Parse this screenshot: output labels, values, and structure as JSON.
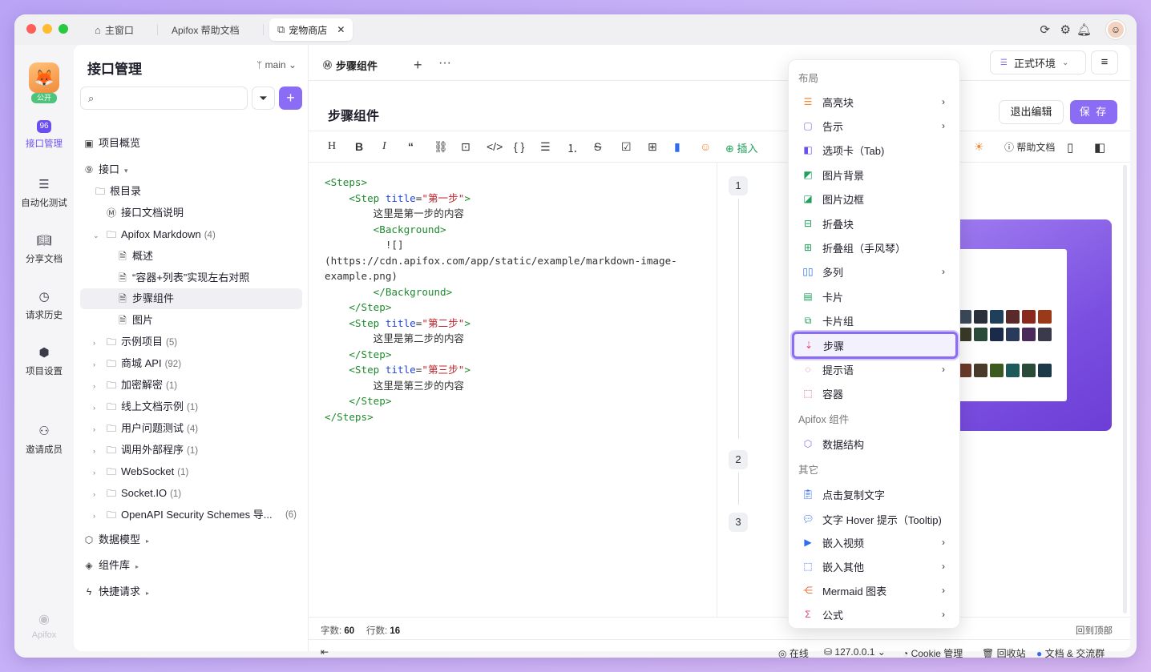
{
  "tabs": [
    {
      "label": "主窗口",
      "icon": "home-icon"
    },
    {
      "label": "Apifox 帮助文档"
    },
    {
      "label": "宠物商店",
      "icon": "external-link-icon",
      "active": true
    }
  ],
  "rail": {
    "badge": "公开",
    "items": [
      {
        "label": "接口管理",
        "icon": "api-icon",
        "active": true
      },
      {
        "label": "自动化测试",
        "icon": "test-icon"
      },
      {
        "label": "分享文档",
        "icon": "book-icon"
      },
      {
        "label": "请求历史",
        "icon": "clock-icon"
      },
      {
        "label": "项目设置",
        "icon": "settings-icon"
      },
      {
        "label": "邀请成员",
        "icon": "user-add-icon"
      }
    ],
    "footer": "Apifox"
  },
  "tree": {
    "title": "接口管理",
    "branch": "main",
    "nodes": [
      {
        "label": "项目概览",
        "icon": "overview-icon"
      },
      {
        "label": "接口",
        "icon": "api-icon"
      },
      {
        "label": "根目录",
        "icon": "folder-icon"
      },
      {
        "label": "接口文档说明",
        "icon": "markdown-icon"
      },
      {
        "label": "Apifox Markdown",
        "count": "(4)",
        "icon": "folder-icon"
      },
      {
        "label": "概述",
        "icon": "doc-icon"
      },
      {
        "label": "“容器+列表”实现左右对照",
        "icon": "doc-icon"
      },
      {
        "label": "步骤组件",
        "icon": "doc-icon",
        "selected": true
      },
      {
        "label": "图片",
        "icon": "doc-icon"
      },
      {
        "label": "示例项目",
        "count": "(5)"
      },
      {
        "label": "商城 API",
        "count": "(92)"
      },
      {
        "label": "加密解密",
        "count": "(1)"
      },
      {
        "label": "线上文档示例",
        "count": "(1)"
      },
      {
        "label": "用户问题测试",
        "count": "(4)"
      },
      {
        "label": "调用外部程序",
        "count": "(1)"
      },
      {
        "label": "WebSocket",
        "count": "(1)"
      },
      {
        "label": "Socket.IO",
        "count": "(1)"
      },
      {
        "label": "OpenAPI Security Schemes 导...",
        "count": "(6)"
      },
      {
        "label": "数据模型",
        "icon": "cube-icon"
      },
      {
        "label": "组件库",
        "icon": "layers-icon"
      },
      {
        "label": "快捷请求",
        "icon": "bolt-icon"
      }
    ]
  },
  "editor": {
    "tab_label": "步骤组件",
    "env": "正式环境",
    "title": "步骤组件",
    "exit": "退出编辑",
    "save": "保 存",
    "insert": "插入",
    "help": "帮助文档",
    "code": [
      "<Steps>",
      "    <Step title=\"第一步\">",
      "        这里是第一步的内容",
      "        <Background>",
      "          ![](https://cdn.apifox.com/app/static/example/markdown-image-example.png)",
      "        </Background>",
      "    </Step>",
      "    <Step title=\"第二步\">",
      "        这里是第二步的内容",
      "    </Step>",
      "    <Step title=\"第三步\">",
      "        这里是第三步的内容",
      "    </Step>",
      "</Steps>"
    ],
    "preview_steps": [
      "1",
      "2",
      "3"
    ],
    "stats": {
      "chars_label": "字数:",
      "chars": "60",
      "lines_label": "行数:",
      "lines": "16"
    },
    "back_to_top": "回到顶部"
  },
  "footer": {
    "online": "在线",
    "ip": "127.0.0.1",
    "cookie": "Cookie 管理",
    "recycle": "回收站",
    "docs": "文档 & 交流群"
  },
  "menu": {
    "sections": [
      "布局",
      "Apifox 组件",
      "其它"
    ],
    "items": [
      {
        "label": "高亮块",
        "icon": "highlight-icon",
        "color": "#f08a3a",
        "submenu": true
      },
      {
        "label": "告示",
        "icon": "notice-icon",
        "color": "#8b6cf5",
        "submenu": true
      },
      {
        "label": "选项卡（Tab)",
        "icon": "tab-icon",
        "color": "#6b4ef0"
      },
      {
        "label": "图片背景",
        "icon": "image-bg-icon",
        "color": "#20a05a"
      },
      {
        "label": "图片边框",
        "icon": "image-frame-icon",
        "color": "#20a05a"
      },
      {
        "label": "折叠块",
        "icon": "collapse-icon",
        "color": "#20a05a"
      },
      {
        "label": "折叠组（手风琴）",
        "icon": "accordion-icon",
        "color": "#20a05a"
      },
      {
        "label": "多列",
        "icon": "columns-icon",
        "color": "#2f6df0",
        "submenu": true
      },
      {
        "label": "卡片",
        "icon": "card-icon",
        "color": "#20a05a"
      },
      {
        "label": "卡片组",
        "icon": "card-group-icon",
        "color": "#20a05a"
      },
      {
        "label": "步骤",
        "icon": "steps-icon",
        "color": "#e04a6a",
        "highlighted": true
      },
      {
        "label": "提示语",
        "icon": "tip-icon",
        "color": "#e04aa0",
        "submenu": true
      },
      {
        "label": "容器",
        "icon": "container-icon",
        "color": "#e04aa0"
      },
      {
        "label": "数据结构",
        "icon": "cube-icon",
        "color": "#8b6cf5"
      },
      {
        "label": "点击复制文字",
        "icon": "clipboard-icon",
        "color": "#2f6df0"
      },
      {
        "label": "文字 Hover 提示（Tooltip)",
        "icon": "tooltip-icon",
        "color": "#2f6df0"
      },
      {
        "label": "嵌入视频",
        "icon": "video-icon",
        "color": "#2f6df0",
        "submenu": true
      },
      {
        "label": "嵌入其他",
        "icon": "embed-icon",
        "color": "#2f6df0",
        "submenu": true
      },
      {
        "label": "Mermaid 图表",
        "icon": "mermaid-icon",
        "color": "#e0632a",
        "submenu": true
      },
      {
        "label": "公式",
        "icon": "sigma-icon",
        "color": "#e04a6a",
        "submenu": true
      }
    ]
  }
}
